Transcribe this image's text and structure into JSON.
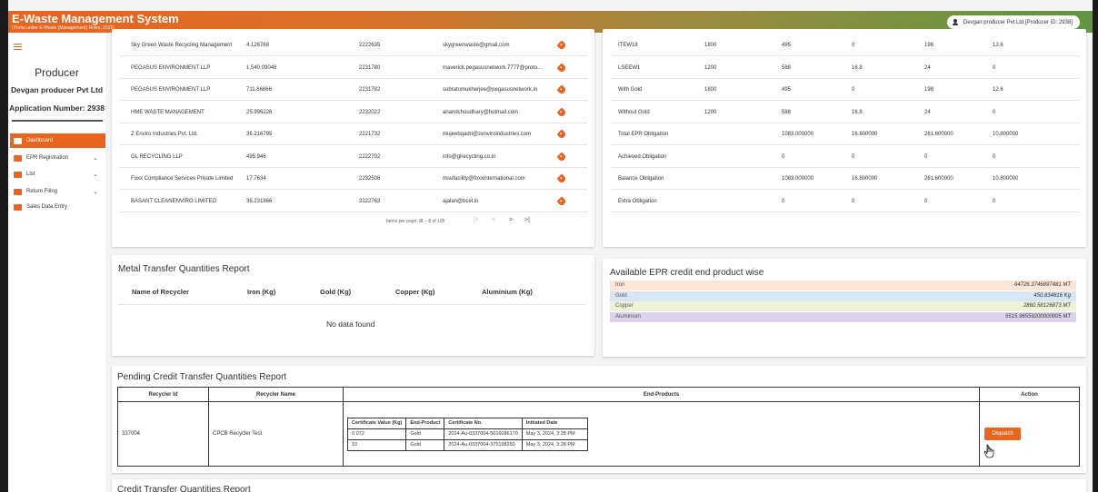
{
  "header": {
    "title": "E-Waste Management System",
    "subtitle": "(Portal under E-Waste (Management) Rules, 2022)",
    "user": "Devgan producer Pvt Ltd [Producer ID: 2938]",
    "gradient": [
      "#e8641f",
      "#5f9740"
    ]
  },
  "sidebar": {
    "role": "Producer",
    "company": "Devgan producer Pvt Ltd",
    "application": "Application Number: 2938",
    "items": [
      {
        "label": "Dashboard",
        "active": true,
        "icon": "dashboard-icon"
      },
      {
        "label": "EPR Registration",
        "icon": "mail-icon",
        "chevron": "⌄"
      },
      {
        "label": "List",
        "icon": "folder-icon",
        "chevron": "⌄"
      },
      {
        "label": "Return Filing",
        "icon": "file-icon",
        "chevron": "⌄"
      },
      {
        "label": "Sales Data Entry",
        "icon": "grid-icon"
      }
    ]
  },
  "recyclers": [
    [
      "Sky Green Waste Recycling Management",
      "4.126768",
      "2222635",
      "skygreenwaste@gmail.com"
    ],
    [
      "PEGASUS ENVIRONMENT LLP",
      "1,540.09048",
      "2231780",
      "maverick.pegasusnetwork.7777@proto..."
    ],
    [
      "PEGASUS ENVIRONMENT LLP",
      "711.66866",
      "2231782",
      "subratomukherjee@pegasusnetwork.in"
    ],
    [
      "HME WASTE MANAGEMENT",
      "25.996226",
      "2232022",
      "anandchoudhary@hotmail.com"
    ],
    [
      "Z Enviro Industries Pvt. Ltd.",
      "36.216795",
      "2221732",
      "mujeebqadri@zenviroindustries.com"
    ],
    [
      "GL RECYCLING LLP",
      "495.946",
      "2222702",
      "info@glrecycling.co.in"
    ],
    [
      "Foxx Compliance Services Private Limited",
      "17.7634",
      "2232508",
      "msufacility@foxxinternational.com"
    ],
    [
      "BASANT CLEANENVIRO LIMITED",
      "36.231866",
      "2222763",
      "ajalan@bcel.in"
    ]
  ],
  "pagination": {
    "items_per_page": "Items per page:  8",
    "range": "1 – 8 of 105"
  },
  "obligations": [
    [
      "ITEW18",
      "1800",
      "495",
      "0",
      "198",
      "12.6"
    ],
    [
      "LSEEW1",
      "1200",
      "588",
      "16.8",
      "24",
      "0"
    ],
    [
      "With Gold",
      "1800",
      "495",
      "0",
      "198",
      "12.6"
    ],
    [
      "Without Gold",
      "1200",
      "588",
      "16.8",
      "24",
      "0"
    ],
    [
      "Total EPR Obligation",
      "",
      "1083.000000",
      "16.800000",
      "261.600000",
      "10.800000"
    ],
    [
      "Achieved Obligation",
      "",
      "0",
      "0",
      "0",
      "0"
    ],
    [
      "Balance Obligation",
      "",
      "1083.000000",
      "16.800000",
      "261.600000",
      "10.800000"
    ],
    [
      "Extra Obligation",
      "",
      "0",
      "0",
      "0",
      "0"
    ]
  ],
  "metal": {
    "title": "Metal Transfer Quantities Report",
    "columns": [
      "Name of Recycler",
      "Iron (Kg)",
      "Gold (Kg)",
      "Copper (Kg)",
      "Aluminium (Kg)"
    ],
    "empty": "No data found"
  },
  "epr_credit": {
    "title": "Available EPR credit end product wise",
    "rows": [
      {
        "name": "Iron",
        "value": "64726.3746897481 MT",
        "color": "#fbe6d8"
      },
      {
        "name": "Gold",
        "value": "450.834816 Kg",
        "color": "#d6e6f7"
      },
      {
        "name": "Copper",
        "value": "2860.58126873 MT",
        "color": "#eef3d6"
      },
      {
        "name": "Aluminium",
        "value": "5515.96559200000005 MT",
        "color": "#ddd3ea"
      }
    ]
  },
  "pending": {
    "title": "Pending Credit Transfer Quantities Report",
    "headers": [
      "Recycler Id",
      "Recycler Name",
      "End-Products",
      "Action"
    ],
    "recycler_id": "337004",
    "recycler_name": "CPCB Recycler Test",
    "inner_headers": [
      "Certificate Value (Kg)",
      "End-Product",
      "Certificate No.",
      "Initiated Date"
    ],
    "inner_rows": [
      [
        "0.072",
        "Gold",
        "2024-Au-0337004-5016086170",
        "May 3, 2024, 3:28 PM"
      ],
      [
        "10",
        "Gold",
        "2024-Au-0337004-375198250",
        "May 3, 2024, 3:28 PM"
      ]
    ],
    "action": "Dispatch"
  },
  "credit_title": "Credit Transfer Quantities Report"
}
